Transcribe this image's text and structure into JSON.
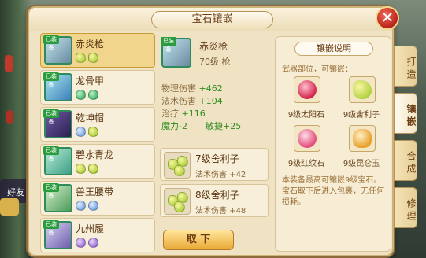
{
  "window": {
    "title": "宝石镶嵌",
    "close_symbol": "✕"
  },
  "items": [
    {
      "name": "赤炎枪",
      "gems": [
        "yellow",
        "yellow"
      ],
      "tag": "已装备",
      "selected": true
    },
    {
      "name": "龙骨甲",
      "gems": [
        "green",
        "green"
      ],
      "tag": "已装备",
      "selected": false
    },
    {
      "name": "乾坤帽",
      "gems": [
        "blue",
        "yellow"
      ],
      "tag": "已装备",
      "selected": false
    },
    {
      "name": "碧水青龙",
      "gems": [
        "yellow",
        "yellow"
      ],
      "tag": "已装备",
      "selected": false
    },
    {
      "name": "兽王腰带",
      "gems": [
        "blue",
        "blue"
      ],
      "tag": "已装备",
      "selected": false
    },
    {
      "name": "九州履",
      "gems": [
        "purple",
        "purple"
      ],
      "tag": "已装备",
      "selected": false
    }
  ],
  "detail": {
    "name": "赤炎枪",
    "level": "70级",
    "type": "枪",
    "tag": "已装备",
    "stats": [
      {
        "label": "物理伤害",
        "value": "+462"
      },
      {
        "label": "法术伤害",
        "value": "+104"
      },
      {
        "label": "治疗",
        "value": "+116"
      }
    ],
    "special": [
      {
        "label": "魔力-2"
      },
      {
        "label": "敏捷+25"
      }
    ]
  },
  "slots": [
    {
      "name": "7级舍利子",
      "attr": "法术伤害",
      "value": "+42"
    },
    {
      "name": "8级舍利子",
      "attr": "法术伤害",
      "value": "+48"
    }
  ],
  "takeoff_button": "取  下",
  "info": {
    "title": "镶嵌说明",
    "subtitle": "武器部位，可镶嵌：",
    "gems": [
      {
        "name": "9级太阳石",
        "color": "red"
      },
      {
        "name": "9级舍利子",
        "color": "green"
      },
      {
        "name": "9级红纹石",
        "color": "pink"
      },
      {
        "name": "9级昆仑玉",
        "color": "orange"
      }
    ],
    "note": "本装备最高可镶嵌9级宝石。宝石取下后进入包裹，无任何损耗。"
  },
  "tabs": [
    {
      "label": "打造",
      "active": false
    },
    {
      "label": "镶嵌",
      "active": true
    },
    {
      "label": "合成",
      "active": false
    },
    {
      "label": "修理",
      "active": false
    }
  ],
  "side": {
    "friend_label": "好友"
  }
}
